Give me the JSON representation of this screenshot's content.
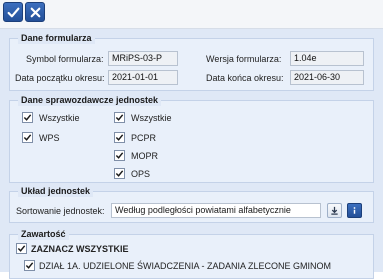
{
  "toolbar": {
    "confirm_icon": "checkmark-icon",
    "cancel_icon": "close-icon",
    "accent": "#2a5aa8"
  },
  "form_data": {
    "legend": "Dane formularza",
    "symbol_label": "Symbol formularza:",
    "symbol_value": "MRiPS-03-P",
    "version_label": "Wersja formularza:",
    "version_value": "1.04e",
    "start_label": "Data początku okresu:",
    "start_value": "2021-01-01",
    "end_label": "Data końca okresu:",
    "end_value": "2021-06-30"
  },
  "units": {
    "legend": "Dane sprawozdawcze jednostek",
    "left": [
      {
        "label": "Wszystkie",
        "checked": true
      },
      {
        "label": "WPS",
        "checked": true
      }
    ],
    "right": [
      {
        "label": "Wszystkie",
        "checked": true
      },
      {
        "label": "PCPR",
        "checked": true
      },
      {
        "label": "MOPR",
        "checked": true
      },
      {
        "label": "OPS",
        "checked": true
      }
    ]
  },
  "layout_section": {
    "legend": "Układ jednostek",
    "sort_label": "Sortowanie jednostek:",
    "sort_value": "Według podległości powiatami alfabetycznie",
    "download_icon": "download-icon",
    "info_icon": "info-icon"
  },
  "contents": {
    "legend": "Zawartość",
    "select_all_label": "ZAZNACZ WSZYSTKIE",
    "select_all_checked": true,
    "items": [
      {
        "label": "DZIAŁ 1A. UDZIELONE ŚWIADCZENIA - ZADANIA ZLECONE GMINOM",
        "checked": true
      }
    ]
  }
}
